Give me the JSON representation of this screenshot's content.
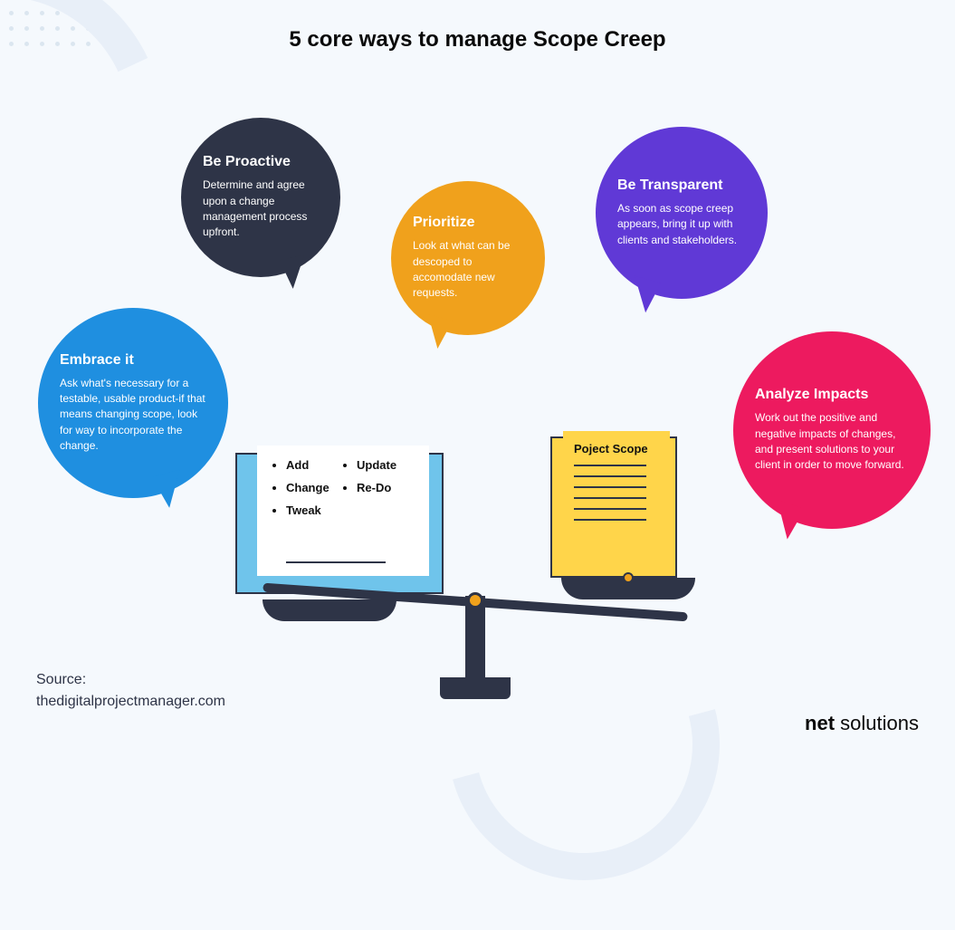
{
  "title": "5 core ways to manage Scope Creep",
  "bubbles": {
    "embrace": {
      "title": "Embrace it",
      "desc": "Ask what's necessary for a testable, usable product-if that means changing scope, look for way to incorporate the change."
    },
    "proactive": {
      "title": "Be Proactive",
      "desc": "Determine and agree upon a change management process upfront."
    },
    "prioritize": {
      "title": "Prioritize",
      "desc": "Look at what can be descoped to accomodate new requests."
    },
    "transparent": {
      "title": "Be Transparent",
      "desc": "As soon as scope creep appears, bring it up with clients and stakeholders."
    },
    "analyze": {
      "title": "Analyze Impacts",
      "desc": "Work out the positive and negative impacts of changes, and present solutions to your client in order to move forward."
    }
  },
  "scale": {
    "left_items": [
      "Add",
      "Change",
      "Tweak",
      "Update",
      "Re-Do"
    ],
    "right_title": "Poject Scope"
  },
  "source": {
    "label": "Source:",
    "value": "thedigitalprojectmanager.com"
  },
  "brand": {
    "part1": "net ",
    "part2": "solutions"
  },
  "colors": {
    "blue": "#1f8fe0",
    "navy": "#2e3447",
    "orange": "#f0a11c",
    "purple": "#6039d6",
    "pink": "#ed1a5f"
  }
}
